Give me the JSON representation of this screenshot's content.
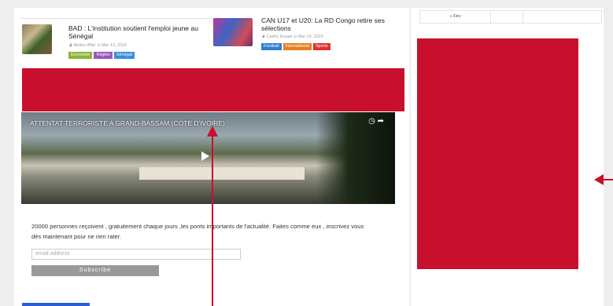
{
  "articles": [
    {
      "title": "BAD : L'institution soutient l'emploi jeune au Sénégal",
      "author": "Abdou Bilal",
      "date": "Mar 13, 2016",
      "tags": [
        {
          "label": "Economie",
          "color": "#8db23a"
        },
        {
          "label": "Région",
          "color": "#9b59b6"
        },
        {
          "label": "Sénégal",
          "color": "#3a8fd6"
        }
      ]
    },
    {
      "title": "CAN U17 et U20: La RD Congo retire ses sélections",
      "author": "Cedric Kouwi",
      "date": "Mar 15, 2016",
      "tags": [
        {
          "label": "Football",
          "color": "#2e7fd4"
        },
        {
          "label": "International",
          "color": "#e67e22"
        },
        {
          "label": "Sports",
          "color": "#e03131"
        }
      ]
    }
  ],
  "video": {
    "title": "ATTENTAT TERRORISTE A GRAND-BASSAM (COTE D'IVOIRE)"
  },
  "signup": {
    "text": "20000 personnes reçoivent , gratuitement chaque jours ,les ponts importants de l'actualité. Faites comme eux , inscrivez vous dès maintenant pour ne rien rater.",
    "email_placeholder": "email address",
    "button_label": "Subscribe"
  },
  "calendar": {
    "prev_label": "« Fév"
  },
  "colors": {
    "ad_red": "#c8102e"
  },
  "icons": [
    "clock-icon",
    "share-icon",
    "play-icon",
    "user-icon"
  ]
}
